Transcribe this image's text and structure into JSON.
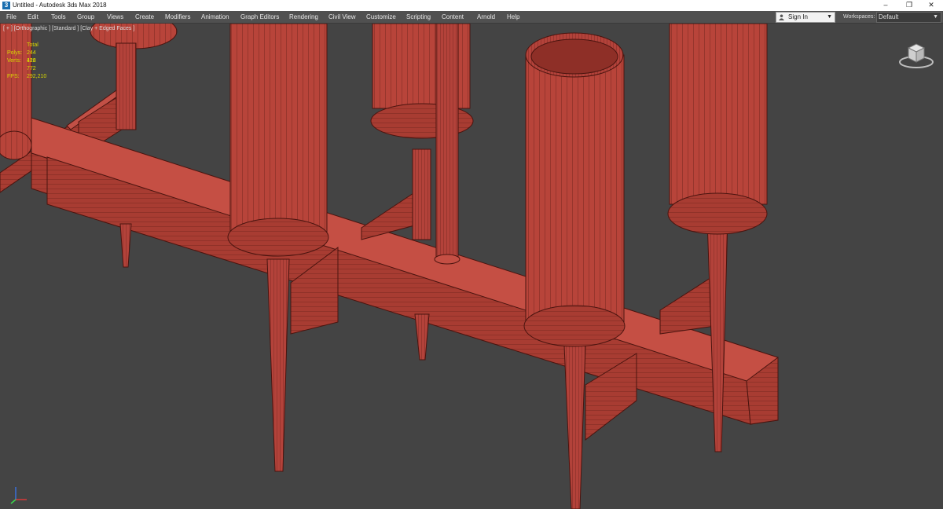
{
  "window": {
    "title": "Untitled - Autodesk 3ds Max 2018",
    "controls": {
      "minimize": "–",
      "restore": "❐",
      "close": "✕"
    }
  },
  "menu": {
    "items": [
      "File",
      "Edit",
      "Tools",
      "Group",
      "Views",
      "Create",
      "Modifiers",
      "Animation",
      "Graph Editors",
      "Rendering",
      "Civil View",
      "Customize",
      "Scripting",
      "Content",
      "Arnold",
      "Help"
    ]
  },
  "account": {
    "sign_in_label": "Sign In"
  },
  "workspaces": {
    "label": "Workspaces:",
    "value": "Default"
  },
  "viewport": {
    "label": "[ + ] [Orthographic ] [Standard ] [Clay + Edged Faces ]",
    "stats": {
      "header": "Total",
      "polys_label": "Polys:",
      "polys_value": "244 416",
      "verts_label": "Verts:",
      "verts_value": "122 772",
      "fps_label": "FPS:",
      "fps_value": "292,210"
    },
    "clay_color": "#b8443a",
    "background_color": "#444444"
  },
  "icons": {
    "app": "3ds-max-logo-icon",
    "viewcube": "viewcube-icon",
    "axis": "axis-tripod-icon",
    "user": "user-icon"
  }
}
